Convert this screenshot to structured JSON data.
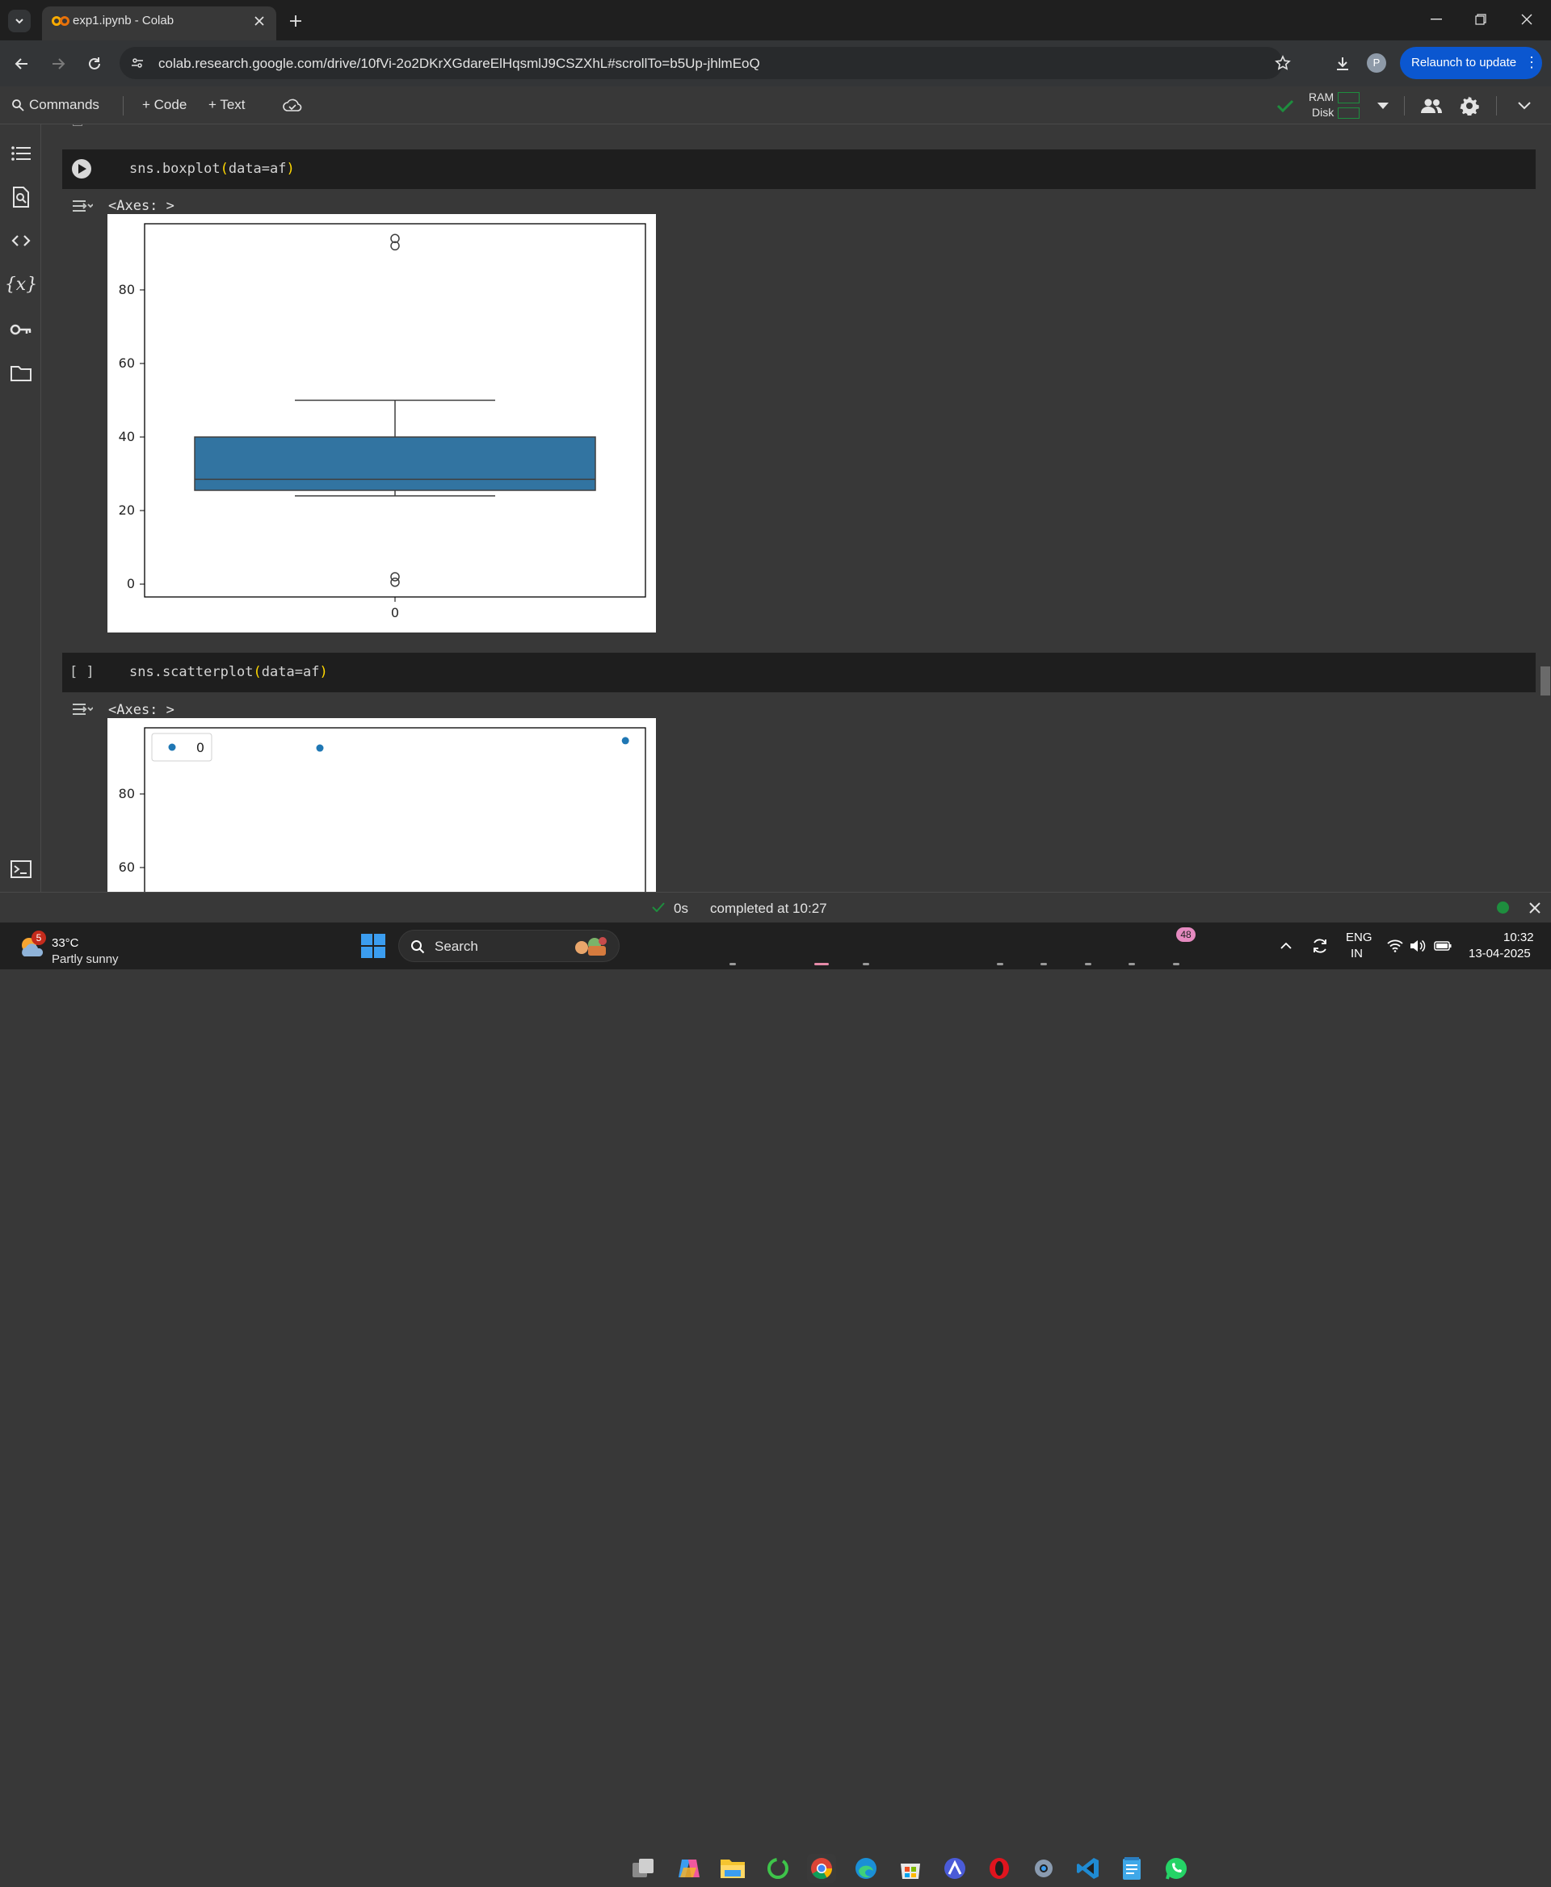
{
  "browser": {
    "tab_title": "exp1.ipynb - Colab",
    "url": "colab.research.google.com/drive/10fVi-2o2DKrXGdareElHqsmlJ9CSZXhL#scrollTo=b5Up-jhlmEoQ",
    "profile_initial": "P",
    "relaunch_label": "Relaunch to update"
  },
  "toolbar": {
    "commands_label": "Commands",
    "code_label": "+ Code",
    "text_label": "+ Text",
    "ram_label": "RAM",
    "disk_label": "Disk"
  },
  "cells": [
    {
      "prompt": "",
      "code_fn": "sns.boxplot",
      "code_arg": "data=af",
      "output_label": "<Axes: >"
    },
    {
      "prompt": "[ ]",
      "code_fn": "sns.scatterplot",
      "code_arg": "data=af",
      "output_label": "<Axes: >"
    }
  ],
  "chart_data": [
    {
      "type": "box",
      "categories": [
        "0"
      ],
      "yticks": [
        "0",
        "20",
        "40",
        "60",
        "80"
      ],
      "ylim": [
        -3.5,
        98
      ],
      "whisker_low": 24,
      "q1": 25.5,
      "median": 28.5,
      "q3": 40,
      "whisker_high": 50,
      "outliers": [
        2,
        0.5,
        94,
        92
      ],
      "color": "#3274a1"
    },
    {
      "type": "scatter",
      "legend": [
        "0"
      ],
      "yticks": [
        "60",
        "80"
      ],
      "ylim": [
        -3.5,
        98
      ],
      "points": [
        {
          "x": 0.35,
          "y": 92.5
        },
        {
          "x": 0.96,
          "y": 94.5
        }
      ],
      "color": "#1f77b4"
    }
  ],
  "status": {
    "elapsed": "0s",
    "completed": "completed at 10:27"
  },
  "taskbar": {
    "weather_badge": "5",
    "temp": "33°C",
    "weather": "Partly sunny",
    "search": "Search",
    "whatsapp_badge": "48",
    "lang1": "ENG",
    "lang2": "IN",
    "time": "10:32",
    "date": "13-04-2025"
  }
}
